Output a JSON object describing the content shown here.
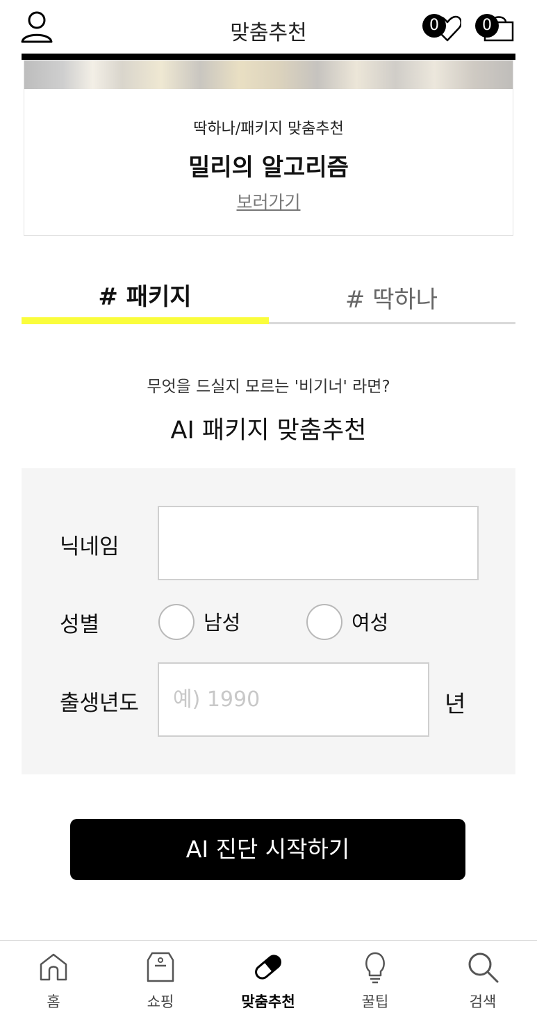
{
  "header": {
    "title": "맞춤추천",
    "profile_icon": "user-icon",
    "wishlist": {
      "icon": "heart-icon",
      "count": "0"
    },
    "cart": {
      "icon": "bag-icon",
      "count": "0"
    }
  },
  "banner": {
    "subtitle": "딱하나/패키지 맞춤추천",
    "title": "밀리의 알고리즘",
    "link": "보러가기"
  },
  "tabs": [
    {
      "label": "# 패키지",
      "active": true
    },
    {
      "label": "# 딱하나",
      "active": false
    }
  ],
  "intro": {
    "line1": "무엇을 드실지 모르는 '비기너' 라면?",
    "line2": "AI 패키지 맞춤추천"
  },
  "form": {
    "nickname_label": "닉네임",
    "nickname_value": "",
    "gender_label": "성별",
    "gender_options": [
      "남성",
      "여성"
    ],
    "birth_year_label": "출생년도",
    "birth_year_placeholder": "예) 1990",
    "birth_year_suffix": "년"
  },
  "start_button": "AI 진단 시작하기",
  "bottom_nav": [
    {
      "label": "홈",
      "icon": "home-icon",
      "active": false
    },
    {
      "label": "쇼핑",
      "icon": "shop-box-icon",
      "active": false
    },
    {
      "label": "맞춤추천",
      "icon": "pill-icon",
      "active": true
    },
    {
      "label": "꿀팁",
      "icon": "lightbulb-icon",
      "active": false
    },
    {
      "label": "검색",
      "icon": "search-icon",
      "active": false
    }
  ],
  "colors": {
    "accent_underline": "#fafd3c",
    "button_bg": "#000000",
    "panel_bg": "#f5f5f5"
  }
}
